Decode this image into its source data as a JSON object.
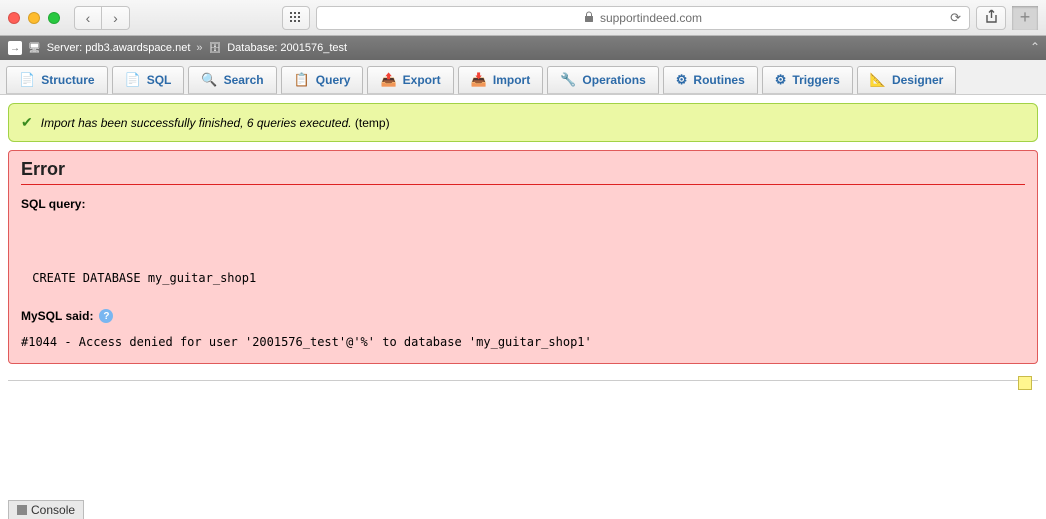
{
  "browser": {
    "url_display": "supportindeed.com"
  },
  "breadcrumb": {
    "server_label": "Server: pdb3.awardspace.net",
    "separator": "»",
    "database_label": "Database: 2001576_test"
  },
  "tabs": [
    {
      "key": "structure",
      "label": "Structure",
      "icon": "📄"
    },
    {
      "key": "sql",
      "label": "SQL",
      "icon": "📄"
    },
    {
      "key": "search",
      "label": "Search",
      "icon": "🔍"
    },
    {
      "key": "query",
      "label": "Query",
      "icon": "📋"
    },
    {
      "key": "export",
      "label": "Export",
      "icon": "📤"
    },
    {
      "key": "import",
      "label": "Import",
      "icon": "📥"
    },
    {
      "key": "operations",
      "label": "Operations",
      "icon": "🔧"
    },
    {
      "key": "routines",
      "label": "Routines",
      "icon": "⚙"
    },
    {
      "key": "triggers",
      "label": "Triggers",
      "icon": "⚙"
    },
    {
      "key": "designer",
      "label": "Designer",
      "icon": "📐"
    }
  ],
  "success": {
    "message_italic": "Import has been successfully finished, 6 queries executed.",
    "message_tail": " (temp)"
  },
  "error": {
    "title": "Error",
    "sql_query_label": "SQL query:",
    "sql_code": " CREATE DATABASE my_guitar_shop1",
    "mysql_said_label": "MySQL said:",
    "detail": "#1044 - Access denied for user '2001576_test'@'%' to database 'my_guitar_shop1'"
  },
  "console": {
    "label": "Console"
  }
}
